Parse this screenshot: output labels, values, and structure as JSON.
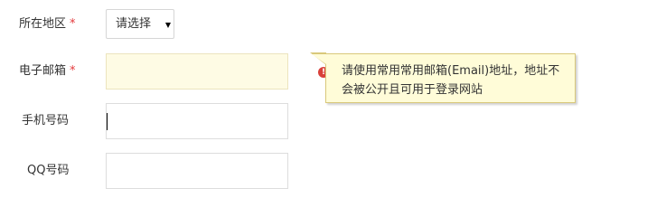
{
  "form": {
    "region": {
      "label": "所在地区",
      "required_mark": "*",
      "selected": "请选择"
    },
    "email": {
      "label": "电子邮箱",
      "required_mark": "*",
      "value": "",
      "state": "error"
    },
    "phone": {
      "label": "手机号码",
      "value": "",
      "focused": true
    },
    "qq": {
      "label": "QQ号码",
      "value": ""
    }
  },
  "tooltip": {
    "text": "请使用常用常用邮箱(Email)地址，地址不会被公开且可用于登录网站"
  },
  "colors": {
    "required_star": "#e4393c",
    "error_field_bg": "#fefbe4",
    "tooltip_bg": "#fffcd8",
    "tooltip_border": "#d9c87a",
    "error_icon": "#d9403a"
  },
  "icons": {
    "select_caret": "triangle-down-icon",
    "error": "error-icon"
  }
}
